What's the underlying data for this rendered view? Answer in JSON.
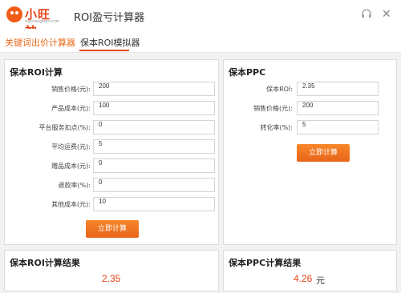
{
  "app": {
    "logo_text": "小旺神",
    "logo_sub": "xiaowangshen.com",
    "title": "ROI盈亏计算器"
  },
  "tabs": [
    {
      "label": "关键词出价计算器"
    },
    {
      "label": "保本ROI模拟器"
    }
  ],
  "roi_panel": {
    "title": "保本ROI计算",
    "fields": [
      {
        "label": "销售价格(元):",
        "value": "200"
      },
      {
        "label": "产品成本(元):",
        "value": "100"
      },
      {
        "label": "平台服务扣点(%):",
        "value": "0"
      },
      {
        "label": "平均运费(元):",
        "value": "5"
      },
      {
        "label": "赠品成本(元):",
        "value": "0"
      },
      {
        "label": "退款率(%):",
        "value": "0"
      },
      {
        "label": "其他成本(元):",
        "value": "10"
      }
    ],
    "button": "立即计算"
  },
  "ppc_panel": {
    "title": "保本PPC",
    "fields": [
      {
        "label": "保本ROI:",
        "value": "2.35"
      },
      {
        "label": "销售价格(元):",
        "value": "200"
      },
      {
        "label": "转化率(%):",
        "value": "5"
      }
    ],
    "button": "立即计算"
  },
  "roi_result": {
    "title": "保本ROI计算结果",
    "value": "2.35"
  },
  "ppc_result": {
    "title": "保本PPC计算结果",
    "value": "4.26",
    "unit": "元"
  },
  "colors": {
    "accent": "#e8441a",
    "button": "#f07a22",
    "tab_active": "#e86a1a"
  },
  "icons": {
    "head": "headphone-icon",
    "close": "close-icon"
  }
}
